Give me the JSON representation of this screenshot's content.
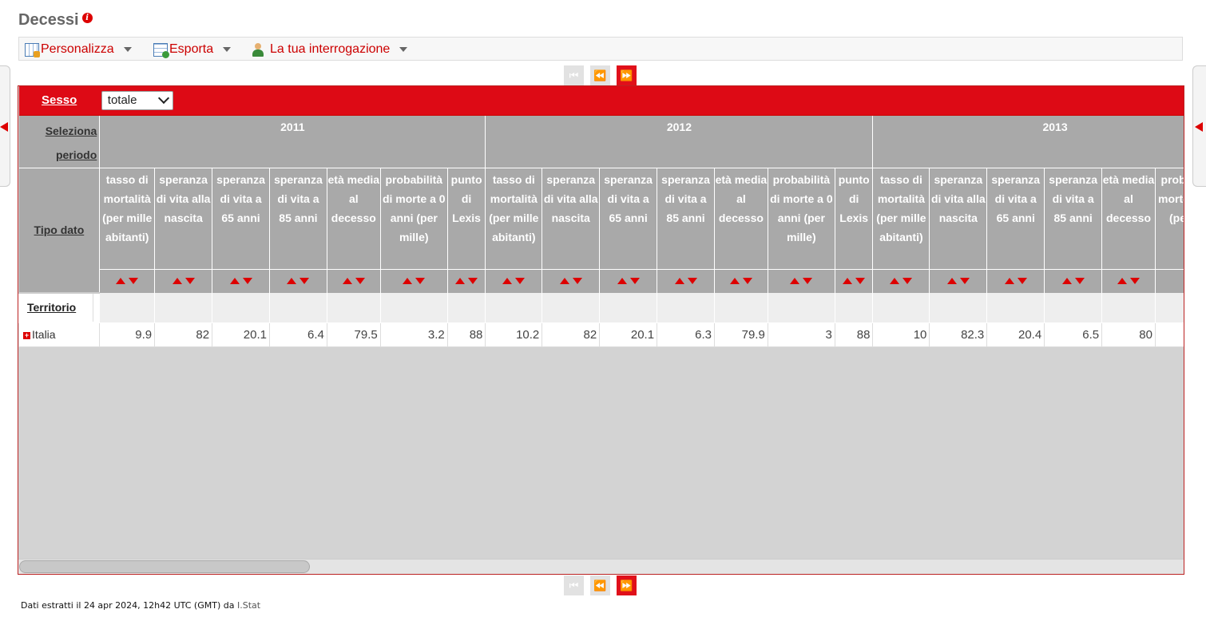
{
  "page": {
    "title": "Decessi",
    "info_icon": "info-icon"
  },
  "toolbar": {
    "customize": "Personalizza",
    "export": "Esporta",
    "query": "La tua interrogazione"
  },
  "pager": {
    "first": "first-page-icon",
    "prev": "prev-page-icon",
    "next": "next-page-icon"
  },
  "table": {
    "sesso_label": "Sesso",
    "sesso_value": "totale",
    "period_label_1": "Seleziona",
    "period_label_2": "periodo",
    "tipo_label": "Tipo dato",
    "territorio_label": "Territorio",
    "years": [
      "2011",
      "2012",
      "2013"
    ],
    "types": [
      "tasso di mortalità (per mille abitanti)",
      "speranza di vita alla nascita",
      "speranza di vita a 65 anni",
      "speranza di vita a 85 anni",
      "età media al decesso",
      "probabilità di morte a 0 anni (per mille)",
      "punto di Lexis"
    ],
    "row": {
      "label": "Italia",
      "values": [
        "9.9",
        "82",
        "20.1",
        "6.4",
        "79.5",
        "3.2",
        "88",
        "10.2",
        "82",
        "20.1",
        "6.3",
        "79.9",
        "3",
        "88",
        "10",
        "82.3",
        "20.4",
        "6.5",
        "80",
        ""
      ]
    }
  },
  "footer": {
    "text": "Dati estratti il 24 apr 2024, 12h42 UTC (GMT) da ",
    "source": "I.Stat"
  },
  "colors": {
    "accent": "#dd0a15",
    "header_gray": "#a9a9a9"
  }
}
